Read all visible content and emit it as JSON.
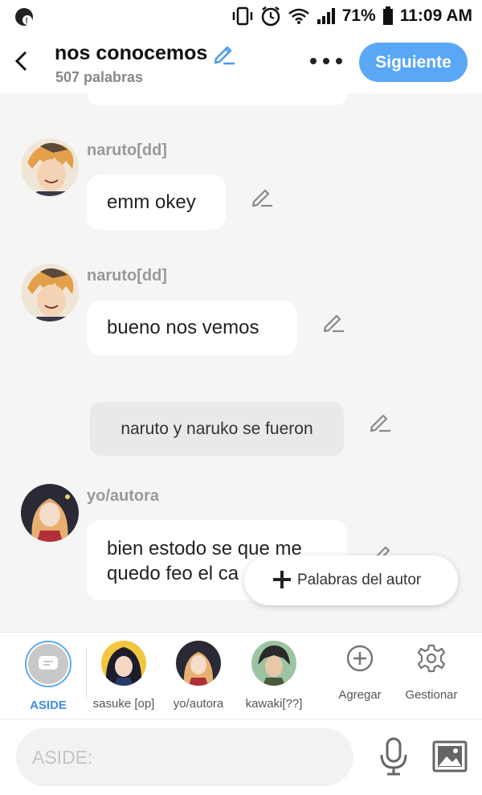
{
  "status_bar": {
    "battery": "71%",
    "time": "11:09 AM"
  },
  "header": {
    "title": "nos conocemos",
    "word_count": "507 palabras",
    "next_label": "Siguiente"
  },
  "messages": [
    {
      "author": "naruto[dd]",
      "text": "emm okey"
    },
    {
      "author": "naruto[dd]",
      "text": "bueno nos vemos"
    },
    {
      "narration": "naruto y naruko se fueron"
    },
    {
      "author": "yo/autora",
      "text_line1": "bien estodo se que me",
      "text_line2": "quedo feo el ca"
    }
  ],
  "popup": {
    "label": "Palabras del autor"
  },
  "characters": [
    {
      "label": "ASIDE",
      "selected": true
    },
    {
      "label": "sasuke [op]"
    },
    {
      "label": "yo/autora"
    },
    {
      "label": "kawaki[??]"
    }
  ],
  "tools": {
    "add_label": "Agregar",
    "manage_label": "Gestionar"
  },
  "input": {
    "placeholder": "ASIDE:"
  },
  "colors": {
    "accent": "#5aa8f5",
    "background": "#f5f5f5"
  }
}
